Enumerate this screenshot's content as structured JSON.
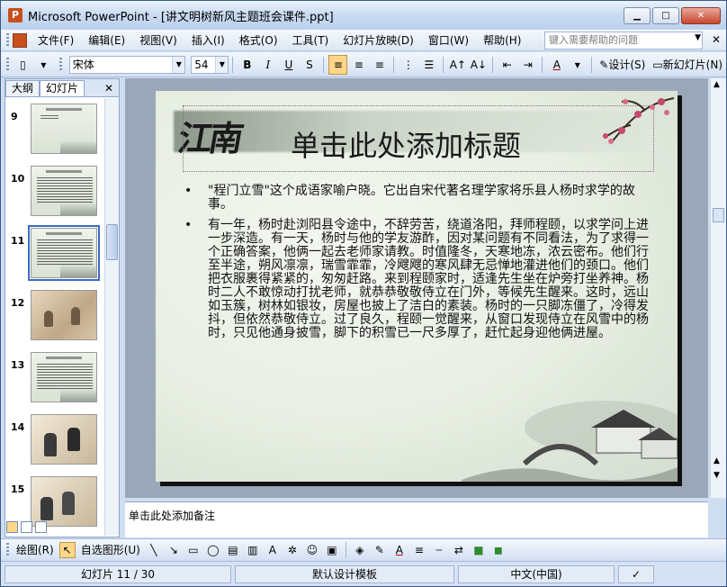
{
  "window": {
    "title": "Microsoft PowerPoint - [讲文明树新风主题班会课件.ppt]",
    "minimize": "▁",
    "restore": "□",
    "close": "✕"
  },
  "menu": {
    "items": [
      "文件(F)",
      "编辑(E)",
      "视图(V)",
      "插入(I)",
      "格式(O)",
      "工具(T)",
      "幻灯片放映(D)",
      "窗口(W)",
      "帮助(H)"
    ],
    "help_placeholder": "键入需要帮助的问题"
  },
  "toolbar": {
    "font": "宋体",
    "size": "54",
    "bold": "B",
    "italic": "I",
    "underline": "U",
    "design_label": "设计(S)",
    "new_slide_label": "新幻灯片(N)"
  },
  "left_pane": {
    "tabs": [
      "大纲",
      "幻灯片"
    ],
    "close": "✕",
    "thumbnails": [
      {
        "num": "9",
        "kind": "text-sparse"
      },
      {
        "num": "10",
        "kind": "text-dense"
      },
      {
        "num": "11",
        "kind": "text-dense",
        "selected": true
      },
      {
        "num": "12",
        "kind": "painting"
      },
      {
        "num": "13",
        "kind": "text-dense"
      },
      {
        "num": "14",
        "kind": "photo"
      },
      {
        "num": "15",
        "kind": "photo"
      }
    ]
  },
  "slide": {
    "calligraphy": "江南",
    "title": "单击此处添加标题",
    "bullets": [
      "\"程门立雪\"这个成语家喻户晓。它出自宋代著名理学家将乐县人杨时求学的故事。",
      "有一年，杨时赴浏阳县令途中，不辞劳苦，绕道洛阳，拜师程颐，以求学问上进一步深造。有一天，杨时与他的学友游酢，因对某问题有不同看法，为了求得一个正确答案，他俩一起去老师家请教。时值隆冬，天寒地冻，浓云密布。他们行至半途，朔风凛凛，瑞雪霏霏，冷飕飕的寒风肆无忌惮地灌进他们的颈口。他们把衣服裹得紧紧的，匆匆赶路。来到程颐家时，适逢先生坐在炉旁打坐养神。杨时二人不敢惊动打扰老师，就恭恭敬敬侍立在门外，等候先生醒来。这时，远山如玉簇，树林如银妆，房屋也披上了洁白的素装。杨时的一只脚冻僵了，冷得发抖，但依然恭敬侍立。过了良久，程颐一觉醒来，从窗口发现侍立在风雪中的杨时，只见他通身披雪，脚下的积雪已一尺多厚了，赶忙起身迎他俩进屋。"
    ]
  },
  "notes": {
    "placeholder": "单击此处添加备注"
  },
  "drawbar": {
    "draw_label": "绘图(R)",
    "autoshapes_label": "自选图形(U)"
  },
  "status": {
    "slide_info": "幻灯片 11 / 30",
    "template": "默认设计模板",
    "language": "中文(中国)"
  }
}
